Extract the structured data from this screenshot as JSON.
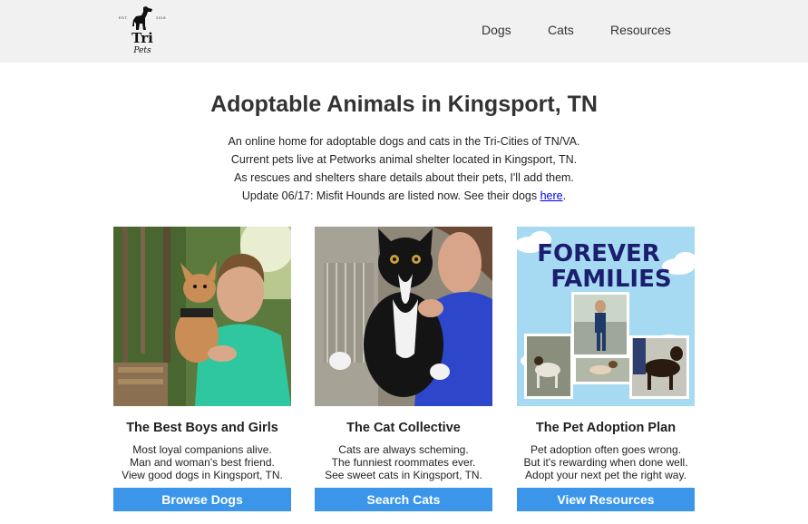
{
  "logo": {
    "est": "EST.",
    "year": "2018",
    "word1": "Tri",
    "word2": "Pets"
  },
  "nav": {
    "dogs": "Dogs",
    "cats": "Cats",
    "resources": "Resources"
  },
  "headline": "Adoptable Animals in Kingsport, TN",
  "intro": {
    "line1": "An online home for adoptable dogs and cats in the Tri-Cities of TN/VA.",
    "line2": "Current pets live at Petworks animal shelter located in Kingsport, TN.",
    "line3": "As rescues and shelters share details about their pets, I'll add them.",
    "line4_prefix": "Update 06/17: Misfit Hounds are listed now. See their dogs ",
    "line4_link": "here",
    "line4_suffix": "."
  },
  "cards": [
    {
      "title": "The Best Boys and Girls",
      "desc": [
        "Most loyal companions alive.",
        "Man and woman's best friend.",
        "View good dogs in Kingsport, TN."
      ],
      "button": "Browse Dogs"
    },
    {
      "title": "The Cat Collective",
      "desc": [
        "Cats are always scheming.",
        "The funniest roommates ever.",
        "See sweet cats in Kingsport, TN."
      ],
      "button": "Search Cats"
    },
    {
      "title": "The Pet Adoption Plan",
      "desc": [
        "Pet adoption often goes wrong.",
        "But it's rewarding when done well.",
        "Adopt your next pet the right way."
      ],
      "button": "View Resources",
      "poster": {
        "line1": "FOREVER",
        "line2": "FAMILIES"
      }
    }
  ],
  "colors": {
    "accent": "#3b96ea",
    "topbar": "#f1f1f1",
    "link": "#0000ee",
    "poster_text": "#1b1d6e"
  },
  "icons": {
    "logo": "dog-silhouette-icon"
  }
}
